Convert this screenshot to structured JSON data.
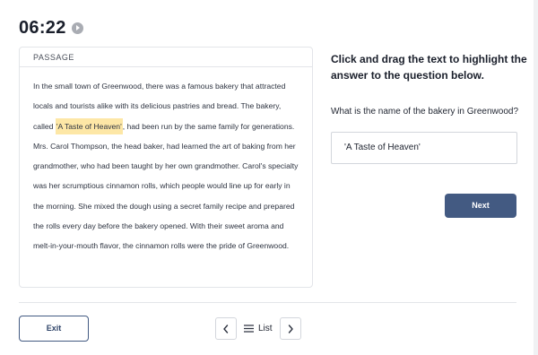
{
  "timer": {
    "time": "06:22",
    "icon": "play-icon"
  },
  "passage": {
    "header": "PASSAGE",
    "text_before": "In the small town of Greenwood, there was a famous bakery that attracted locals and tourists alike with its delicious pastries and bread. The bakery, called ",
    "highlight": "'A Taste of Heaven'",
    "text_after": ", had been run by the same family for generations. Mrs. Carol Thompson, the head baker, had learned the art of baking from her grandmother, who had been taught by her own grandmother. Carol's specialty was her scrumptious cinnamon rolls, which people would line up for early in the morning. She mixed the dough using a secret family recipe and prepared the rolls every day before the bakery opened. With their sweet aroma and melt-in-your-mouth flavor, the cinnamon rolls were the pride of Greenwood.",
    "highlight_color": "#fde7a6"
  },
  "task": {
    "instructions": "Click and drag the text to highlight the answer to the question below.",
    "question": "What is the name of the bakery in Greenwood?",
    "answer": "'A Taste of Heaven'"
  },
  "buttons": {
    "next": "Next",
    "exit": "Exit",
    "list": "List"
  },
  "icons": {
    "prev": "chevron-left-icon",
    "next": "chevron-right-icon",
    "list": "list-icon"
  },
  "colors": {
    "primary": "#435a82",
    "highlight": "#fde7a6"
  }
}
